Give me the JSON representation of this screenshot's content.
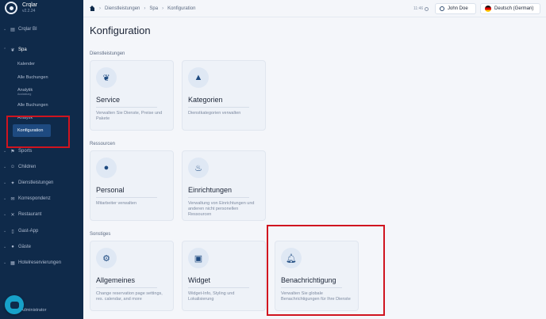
{
  "app": {
    "name": "Crqlar",
    "version": "v2.2.24"
  },
  "sidebar": {
    "items": [
      {
        "label": "Crqlar BI",
        "icon": "chart-icon"
      },
      {
        "label": "Spa",
        "icon": "lotus-icon"
      },
      {
        "label": "Sports",
        "icon": "sports-icon"
      },
      {
        "label": "Children",
        "icon": "children-icon"
      },
      {
        "label": "Dienstleistungen",
        "icon": "services-icon"
      },
      {
        "label": "Korrespondenz",
        "icon": "mail-icon"
      },
      {
        "label": "Restaurant",
        "icon": "restaurant-icon"
      },
      {
        "label": "Gast-App",
        "icon": "phone-icon"
      },
      {
        "label": "Gäste",
        "icon": "guests-icon"
      },
      {
        "label": "Hotelreservierungen",
        "icon": "hotel-icon"
      }
    ],
    "spa_sub": [
      {
        "label": "Kalender"
      },
      {
        "label": "Alle Buchungen"
      },
      {
        "label": "Analytik",
        "small": "Auslastung"
      },
      {
        "label": "Alle Buchungen"
      },
      {
        "label": "Analytik"
      },
      {
        "label": "Konfiguration"
      }
    ],
    "footer_label": "Administrator"
  },
  "topbar": {
    "breadcrumb": [
      "Dienstleistungen",
      "Spa",
      "Konfiguration"
    ],
    "time": "11:46",
    "user": "John Doe",
    "language": "Deutsch (German)"
  },
  "page": {
    "title": "Konfiguration",
    "sections": [
      {
        "label": "Dienstleistungen",
        "cards": [
          {
            "title": "Service",
            "desc": "Verwalten Sie Dienste, Preise und Pakete",
            "icon": "lotus-icon"
          },
          {
            "title": "Kategorien",
            "desc": "Dienstkategorien verwalten",
            "icon": "shapes-icon"
          }
        ]
      },
      {
        "label": "Ressourcen",
        "cards": [
          {
            "title": "Personal",
            "desc": "Mitarbeiter verwalten",
            "icon": "person-icon"
          },
          {
            "title": "Einrichtungen",
            "desc": "Verwaltung von Einrichtungen und anderen nicht personellen Ressourcen",
            "icon": "bathtub-icon"
          }
        ]
      },
      {
        "label": "Sonstiges",
        "cards": [
          {
            "title": "Allgemeines",
            "desc": "Change reservation page settings, res. calendar, and more",
            "icon": "gear-icon"
          },
          {
            "title": "Widget",
            "desc": "Widget-Info, Styling und Lokalisierung",
            "icon": "widgets-icon"
          },
          {
            "title": "Benachrichtigung",
            "desc": "Verwalten Sie globale Benachrichtigungen für Ihre Dienste",
            "icon": "bell-icon"
          }
        ]
      }
    ]
  },
  "colors": {
    "sidebar": "#0f2a4a",
    "accent": "#1e4a80",
    "highlight": "#d0141f",
    "chat": "#17a1c9"
  }
}
